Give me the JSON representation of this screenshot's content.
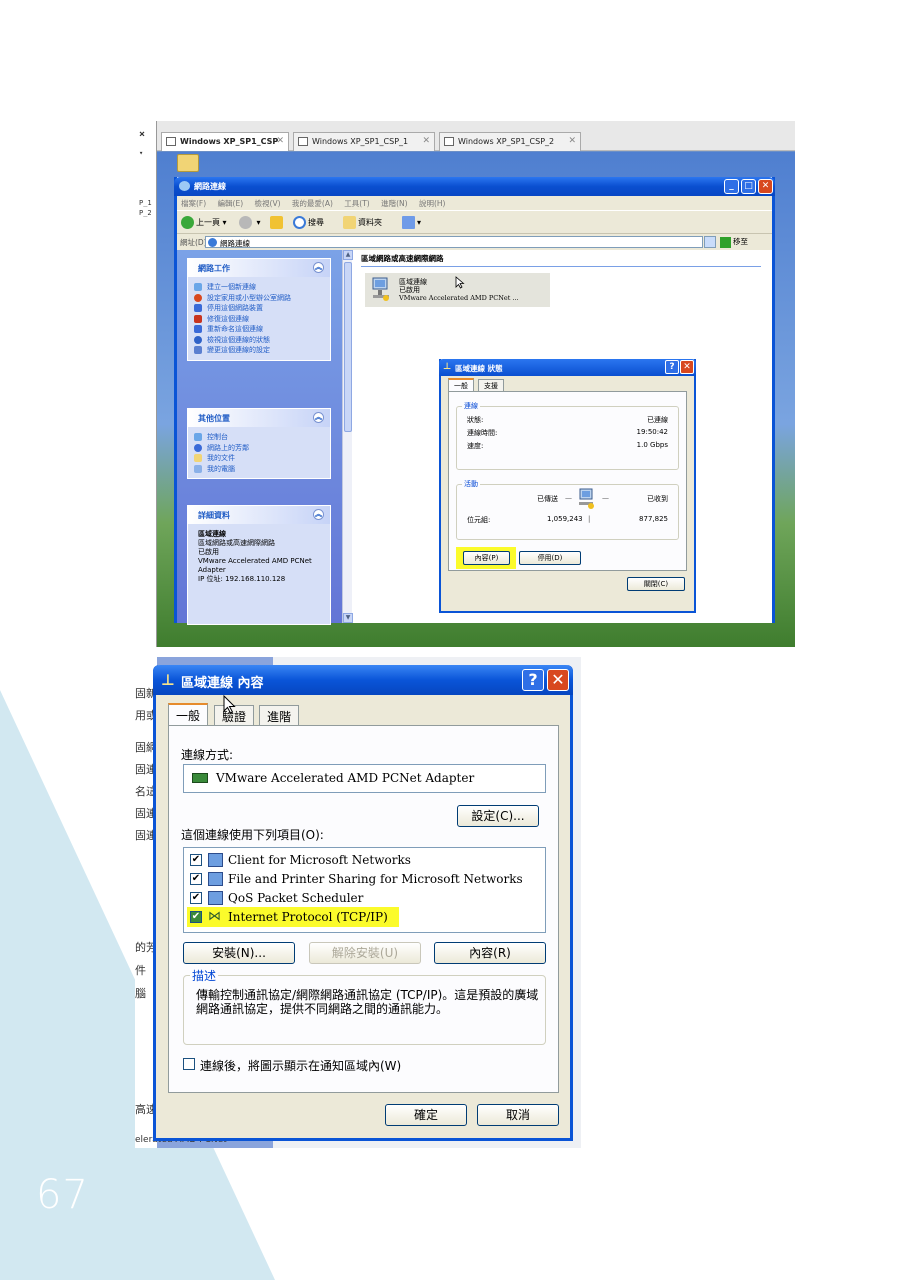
{
  "page_number": "67",
  "vm": {
    "tabs": [
      "Windows XP_SP1_CSP",
      "Windows XP_SP1_CSP_1",
      "Windows XP_SP1_CSP_2"
    ],
    "left_labels": [
      "P_1",
      "P_2"
    ]
  },
  "explorer": {
    "title": "網路連線",
    "menu": [
      "檔案(F)",
      "編輯(E)",
      "檢視(V)",
      "我的最愛(A)",
      "工具(T)",
      "進階(N)",
      "說明(H)"
    ],
    "toolbar": {
      "back": "上一頁",
      "search": "搜尋",
      "folders": "資料夾"
    },
    "address_label": "網址(D)",
    "address_value": "網路連線",
    "go_label": "移至",
    "tasks": {
      "title": "網路工作",
      "items": [
        "建立一個新連線",
        "設定家用或小型辦公室網路",
        "停用這個網路裝置",
        "修復這個連線",
        "重新命名這個連線",
        "檢視這個連線的狀態",
        "變更這個連線的設定"
      ]
    },
    "other": {
      "title": "其他位置",
      "items": [
        "控制台",
        "網路上的芳鄰",
        "我的文件",
        "我的電腦"
      ]
    },
    "details": {
      "title": "詳細資料",
      "name": "區域連線",
      "lines": [
        "區域網路或高速網際網路",
        "已啟用",
        "VMware Accelerated AMD PCNet Adapter",
        "IP 位址: 192.168.110.128"
      ]
    },
    "group_header": "區域網路或高速網際網路",
    "connection": {
      "name": "區域連線",
      "status": "已啟用",
      "device": "VMware Accelerated AMD PCNet ..."
    }
  },
  "status_dialog": {
    "title": "區域連線 狀態",
    "tabs": [
      "一般",
      "支援"
    ],
    "connection_group": "連線",
    "rows": [
      {
        "label": "狀態:",
        "value": "已連線"
      },
      {
        "label": "連線時間:",
        "value": "19:50:42"
      },
      {
        "label": "速度:",
        "value": "1.0 Gbps"
      }
    ],
    "activity_group": "活動",
    "sent_label": "已傳送",
    "received_label": "已收到",
    "bytes_label": "位元組:",
    "bytes_sent": "1,059,243",
    "bytes_received": "877,825",
    "properties_button": "內容(P)",
    "disable_button": "停用(D)",
    "close_button": "關閉(C)"
  },
  "props_dialog": {
    "title": "區域連線 內容",
    "tabs": [
      "一般",
      "驗證",
      "進階"
    ],
    "connect_using_label": "連線方式:",
    "adapter": "VMware Accelerated AMD PCNet Adapter",
    "configure_button": "設定(C)...",
    "items_label": "這個連線使用下列項目(O):",
    "items": [
      {
        "label": "Client for Microsoft Networks",
        "checked": true
      },
      {
        "label": "File and Printer Sharing for Microsoft Networks",
        "checked": true
      },
      {
        "label": "QoS Packet Scheduler",
        "checked": true
      },
      {
        "label": "Internet Protocol (TCP/IP)",
        "checked": true
      }
    ],
    "install_button": "安裝(N)...",
    "uninstall_button": "解除安裝(U)",
    "properties_button": "內容(R)",
    "description_group": "描述",
    "description": "傳輸控制通訊協定/網際網路通訊協定 (TCP/IP)。這是預設的廣域網路通訊協定，提供不同網路之間的通訊能力。",
    "notify_label": "連線後，將圖示顯示在通知區域內(W)",
    "ok_button": "確定",
    "cancel_button": "取消"
  },
  "background_fragments": [
    "固新",
    "用或",
    "固網",
    "固連",
    "名這",
    "固連",
    "固連",
    "的芳",
    "件",
    "腦",
    "高速",
    "elerated AMD PCNet"
  ],
  "colors": {
    "xp_title": "#0a54d6",
    "highlight": "#fbfb2b",
    "triangle": "#d2e8f1"
  }
}
